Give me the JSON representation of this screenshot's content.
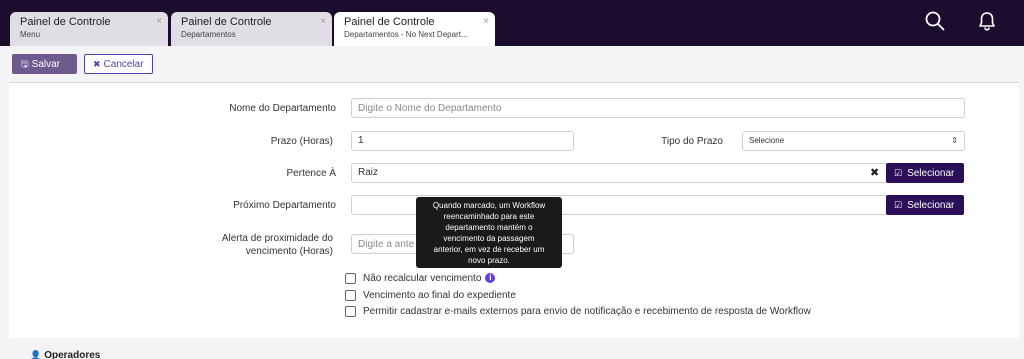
{
  "tabs": [
    {
      "title": "Painel de Controle",
      "subtitle": "Menu",
      "close": "×"
    },
    {
      "title": "Painel de Controle",
      "subtitle": "Departamentos",
      "close": "×"
    },
    {
      "title": "Painel de Controle",
      "subtitle": "Departamentos - No Next Depart...",
      "close": "×"
    }
  ],
  "header": {
    "search_icon": "search-icon",
    "bell_icon": "bell-icon"
  },
  "toolbar": {
    "save_label": "Salvar",
    "cancel_label": "Cancelar"
  },
  "form": {
    "nome": {
      "label": "Nome do Departamento",
      "placeholder": "Digite o Nome do Departamento",
      "value": ""
    },
    "prazo": {
      "label": "Prazo (Horas)",
      "value": "1"
    },
    "tipo_prazo": {
      "label": "Tipo do Prazo",
      "value": "Selecione"
    },
    "pertence": {
      "label": "Pertence À",
      "value": "Raiz",
      "clear": "✖",
      "button": "Selecionar"
    },
    "proximo": {
      "label": "Próximo Departamento",
      "value": "",
      "button": "Selecionar"
    },
    "alerta": {
      "label_line1": "Alerta de proximidade do",
      "label_line2": "vencimento (Horas)",
      "placeholder": "Digite a ante"
    },
    "checks": [
      {
        "label": "Não recalcular vencimento",
        "checked": false
      },
      {
        "label": "Vencimento ao final do expediente",
        "checked": false
      },
      {
        "label": "Permitir cadastrar e-mails externos para envio de notificação e recebimento de resposta de Workflow",
        "checked": false
      }
    ],
    "tooltip_lines": [
      "Quando marcado, um Workflow",
      "reencaminhado para este",
      "departamento mantém o",
      "vencimento da passagem",
      "anterior, em vez de receber um",
      "novo prazo."
    ]
  },
  "section": {
    "title": "Operadores"
  },
  "colors": {
    "topbar": "#1c0d2e",
    "accent": "#2a0f58",
    "save_button": "#6e5a8e",
    "info": "#6a3fe0"
  }
}
